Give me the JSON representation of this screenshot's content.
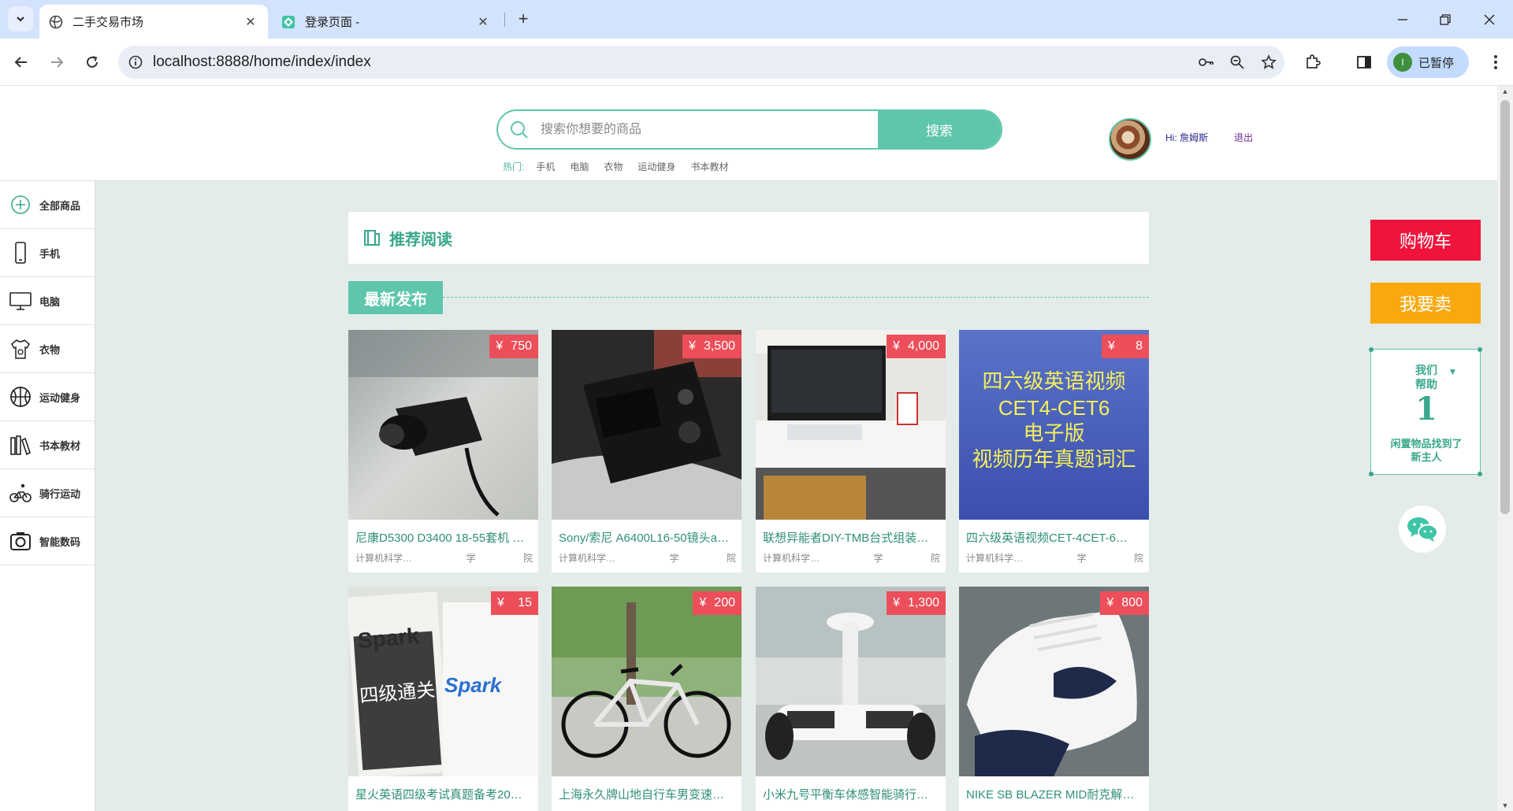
{
  "browser": {
    "tabs": [
      {
        "title": "二手交易市场",
        "active": true
      },
      {
        "title": "登录页面 -",
        "active": false
      }
    ],
    "url": "localhost:8888/home/index/index",
    "profile_initial": "I",
    "profile_label": "已暂停"
  },
  "header": {
    "search_placeholder": "搜索你想要的商品",
    "search_button": "搜索",
    "hot_label": "热门:",
    "hot_tags": [
      "手机",
      "电脑",
      "衣物",
      "运动健身",
      "书本教材"
    ],
    "user_greeting": "Hi: 詹姆斯",
    "logout": "退出"
  },
  "sidebar": {
    "items": [
      {
        "label": "全部商品",
        "icon": "plus-circle-icon"
      },
      {
        "label": "手机",
        "icon": "phone-icon"
      },
      {
        "label": "电脑",
        "icon": "monitor-icon"
      },
      {
        "label": "衣物",
        "icon": "shirt-icon"
      },
      {
        "label": "运动健身",
        "icon": "basketball-icon"
      },
      {
        "label": "书本教材",
        "icon": "books-icon"
      },
      {
        "label": "骑行运动",
        "icon": "cyclist-icon"
      },
      {
        "label": "智能数码",
        "icon": "camera-icon"
      }
    ]
  },
  "main": {
    "recommend_title": "推荐阅读",
    "newest_title": "最新发布",
    "products": [
      {
        "name": "尼康D5300 D3400 18-55套机 …",
        "price": "750",
        "college": "计算机科学…",
        "grade": "学",
        "dept": "院"
      },
      {
        "name": "Sony/索尼 A6400L16-50镜头a…",
        "price": "3,500",
        "college": "计算机科学…",
        "grade": "学",
        "dept": "院"
      },
      {
        "name": "联想异能者DIY-TMB台式组装…",
        "price": "4,000",
        "college": "计算机科学…",
        "grade": "学",
        "dept": "院"
      },
      {
        "name": "四六级英语视频CET-4CET-6…",
        "price": "8",
        "college": "计算机科学…",
        "grade": "学",
        "dept": "院"
      },
      {
        "name": "星火英语四级考试真题备考20…",
        "price": "15",
        "college": "",
        "grade": "",
        "dept": ""
      },
      {
        "name": "上海永久牌山地自行车男变速…",
        "price": "200",
        "college": "",
        "grade": "",
        "dept": ""
      },
      {
        "name": "小米九号平衡车体感智能骑行…",
        "price": "1,300",
        "college": "",
        "grade": "",
        "dept": ""
      },
      {
        "name": "NIKE SB BLAZER MID耐克解…",
        "price": "800",
        "college": "",
        "grade": "",
        "dept": ""
      }
    ],
    "cet_image_text": [
      "四六级英语视频",
      "CET4-CET6",
      "电子版",
      "视频历年真题词汇"
    ],
    "spark_text": [
      "Spark",
      "四级通关",
      "Spark"
    ]
  },
  "right_panel": {
    "cart": "购物车",
    "sell": "我要卖",
    "help_title_1": "我们",
    "help_title_2": "帮助",
    "help_count": "1",
    "help_desc_1": "闲置物品找到了",
    "help_desc_2": "新主人"
  },
  "colors": {
    "accent": "#5fc6ac",
    "price": "#ec4f5a",
    "cart": "#f0143c",
    "sell": "#f9a90e",
    "page_bg": "#e4ecea"
  }
}
